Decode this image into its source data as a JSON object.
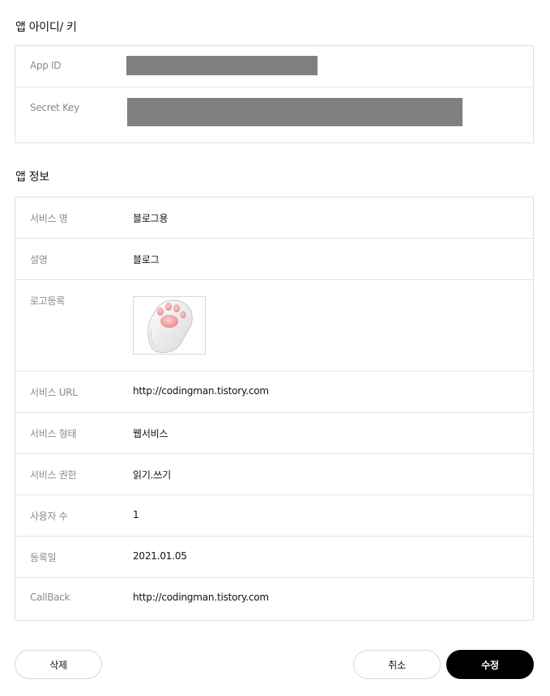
{
  "sections": {
    "keys_title": "앱 아이디/ 키",
    "info_title": "앱 정보"
  },
  "keys": {
    "app_id_label": "App ID",
    "secret_key_label": "Secret Key"
  },
  "info": {
    "service_name_label": "서비스 명",
    "service_name_value": "블로그용",
    "description_label": "설명",
    "description_value": "블로그",
    "logo_label": "로고등록",
    "service_url_label": "서비스 URL",
    "service_url_value": "http://codingman.tistory.com",
    "service_type_label": "서비스 형태",
    "service_type_value": "웹서비스",
    "service_permission_label": "서비스 권한",
    "service_permission_value": "읽기.쓰기",
    "user_count_label": "사용자 수",
    "user_count_value": "1",
    "registered_label": "등록일",
    "registered_value": "2021.01.05",
    "callback_label": "CallBack",
    "callback_value": "http://codingman.tistory.com"
  },
  "buttons": {
    "delete": "삭제",
    "cancel": "취소",
    "edit": "수정"
  },
  "colors": {
    "masked": "#808080",
    "primary_button": "#000000"
  },
  "icons": {
    "logo": "cat-paw-icon"
  }
}
